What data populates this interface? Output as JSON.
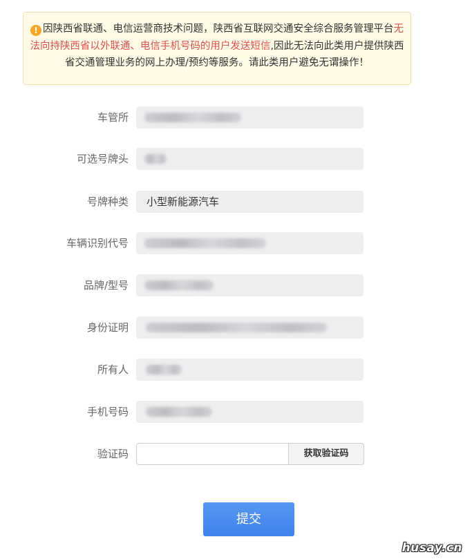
{
  "notice": {
    "icon": "exclamation-icon",
    "text_before": "因陕西省联通、电信运营商技术问题，陕西省互联网交通安全综合服务管理平台",
    "text_highlight": "无法向持陕西省以外联通、电信手机号码的用户发送短信",
    "text_after": ",因此无法向此类用户提供陕西省交通管理业务的网上办理/预约等服务。请此类用户避免无谓操作！",
    "highlight_color": "#d9534f"
  },
  "form": {
    "fields": [
      {
        "label": "车管所",
        "value": ""
      },
      {
        "label": "可选号牌头",
        "value": ""
      },
      {
        "label": "号牌种类",
        "value": "小型新能源汽车"
      },
      {
        "label": "车辆识别代号",
        "value": ""
      },
      {
        "label": "品牌/型号",
        "value": ""
      },
      {
        "label": "身份证明",
        "value": ""
      },
      {
        "label": "所有人",
        "value": ""
      },
      {
        "label": "手机号码",
        "value": ""
      }
    ],
    "captcha_label": "验证码",
    "captcha_value": "",
    "captcha_button": "获取验证码",
    "submit_label": "提交"
  },
  "colors": {
    "accent": "#4a8cf0",
    "field_bg": "#eeeeee",
    "notice_bg": "#fffbe6"
  },
  "watermark": "husay.cn"
}
